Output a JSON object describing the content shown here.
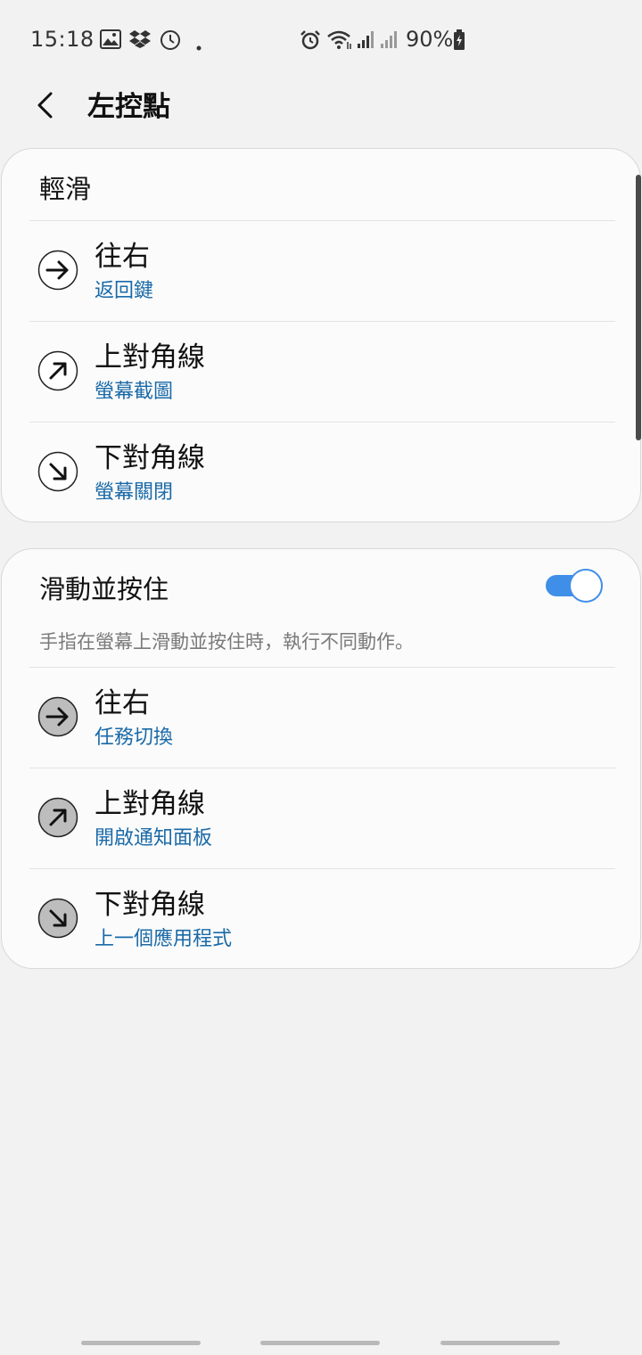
{
  "status_bar": {
    "time": "15:18",
    "battery": "90%",
    "icons": [
      "gallery-icon",
      "dropbox-icon",
      "clock-icon",
      "dot-icon",
      "alarm-icon",
      "wifi-icon",
      "signal-icon",
      "signal-icon",
      "battery-charging-icon"
    ]
  },
  "header": {
    "back_icon": "chevron-left-icon",
    "title": "左控點"
  },
  "swipe_section": {
    "title": "輕滑",
    "items": [
      {
        "label": "往右",
        "value": "返回鍵",
        "icon": "arrow-right-icon"
      },
      {
        "label": "上對角線",
        "value": "螢幕截圖",
        "icon": "arrow-up-right-icon"
      },
      {
        "label": "下對角線",
        "value": "螢幕關閉",
        "icon": "arrow-down-right-icon"
      }
    ]
  },
  "hold_section": {
    "title": "滑動並按住",
    "description": "手指在螢幕上滑動並按住時，執行不同動作。",
    "toggle_on": true,
    "items": [
      {
        "label": "往右",
        "value": "任務切換",
        "icon": "arrow-right-icon"
      },
      {
        "label": "上對角線",
        "value": "開啟通知面板",
        "icon": "arrow-up-right-icon"
      },
      {
        "label": "下對角線",
        "value": "上一個應用程式",
        "icon": "arrow-down-right-icon"
      }
    ]
  },
  "colors": {
    "accent": "#3f8ee8",
    "value_text": "#1a6aa8",
    "background": "#f2f2f2",
    "card": "#fbfbfb"
  }
}
